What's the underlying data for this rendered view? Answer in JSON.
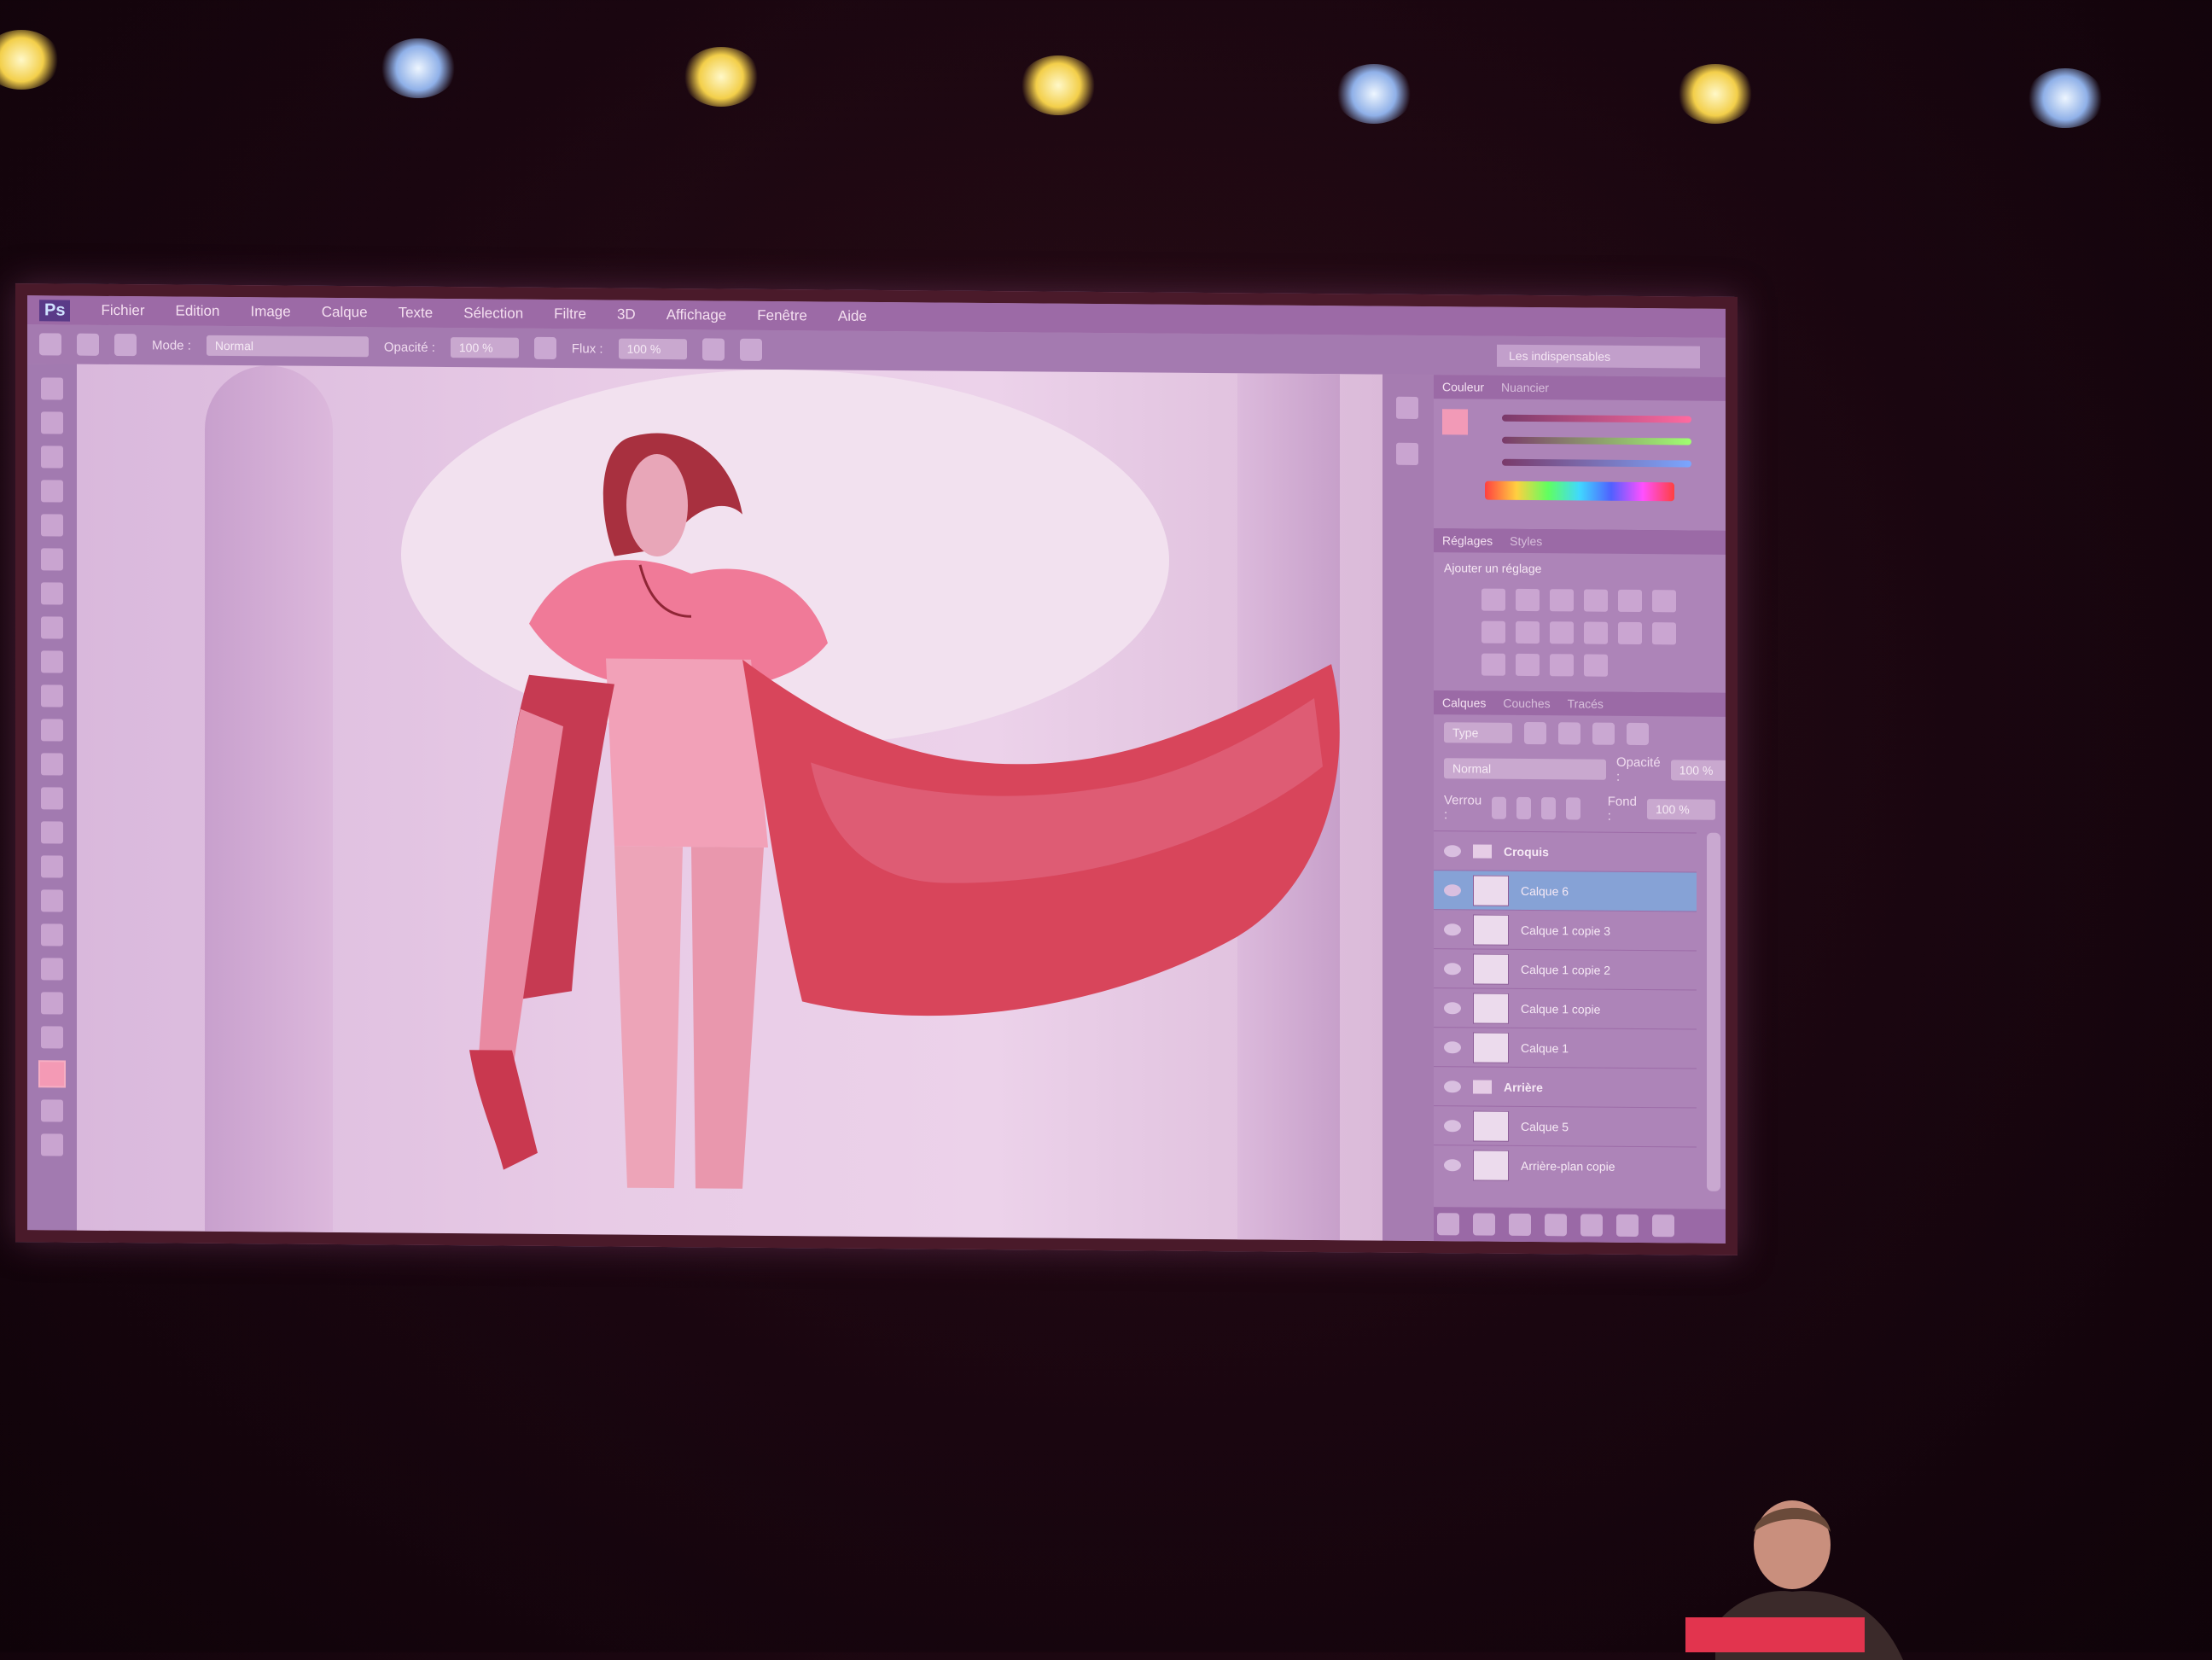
{
  "app": {
    "logo": "Ps",
    "menu": [
      "Fichier",
      "Edition",
      "Image",
      "Calque",
      "Texte",
      "Sélection",
      "Filtre",
      "3D",
      "Affichage",
      "Fenêtre",
      "Aide"
    ]
  },
  "options_bar": {
    "mode_label": "Mode :",
    "mode_value": "Normal",
    "opacity_label": "Opacité :",
    "opacity_value": "100 %",
    "flow_label": "Flux :",
    "flow_value": "100 %",
    "workspace": "Les indispensables"
  },
  "color_panel": {
    "tabs": [
      "Couleur",
      "Nuancier"
    ],
    "slider_colors": [
      "#ff6aa0",
      "#a0ff70",
      "#7aa6ff"
    ]
  },
  "adjustments_panel": {
    "tabs": [
      "Réglages",
      "Styles"
    ],
    "title": "Ajouter un réglage"
  },
  "layers_panel": {
    "tabs": [
      "Calques",
      "Couches",
      "Tracés"
    ],
    "kind_filter": "Type",
    "blend_mode": "Normal",
    "opacity_label": "Opacité :",
    "opacity_value": "100 %",
    "lock_label": "Verrou :",
    "fill_label": "Fond :",
    "fill_value": "100 %",
    "layers": [
      {
        "name": "Croquis",
        "type": "group"
      },
      {
        "name": "Calque 6",
        "type": "layer",
        "selected": true
      },
      {
        "name": "Calque 1 copie 3",
        "type": "layer"
      },
      {
        "name": "Calque 1 copie 2",
        "type": "layer"
      },
      {
        "name": "Calque 1 copie",
        "type": "layer"
      },
      {
        "name": "Calque 1",
        "type": "layer"
      },
      {
        "name": "Arrière",
        "type": "group"
      },
      {
        "name": "Calque 5",
        "type": "layer"
      },
      {
        "name": "Arrière-plan copie",
        "type": "layer"
      }
    ]
  },
  "colors": {
    "screen_tint": "#b38ab6",
    "figure_red": "#d8455b",
    "selection_blue": "#86a2d6"
  }
}
